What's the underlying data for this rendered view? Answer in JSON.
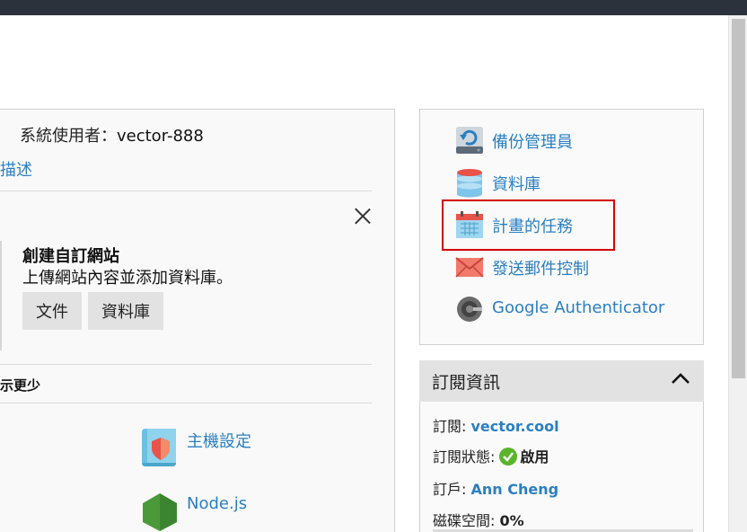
{
  "user": {
    "prefix": "系統使用者：",
    "name": "vector-888"
  },
  "left": {
    "desc_link": "描述",
    "card_title": "創建自訂網站",
    "card_subtitle": "上傳網站內容並添加資料庫。",
    "btn_files": "文件",
    "btn_database": "資料庫",
    "show_less": "示更少",
    "tools": [
      {
        "label": "主機設定",
        "icon": "hosting-settings-icon"
      },
      {
        "label": "Node.js",
        "icon": "nodejs-icon"
      }
    ]
  },
  "right": {
    "items": [
      {
        "label": "備份管理員",
        "icon": "backup-manager-icon"
      },
      {
        "label": "資料庫",
        "icon": "database-icon"
      },
      {
        "label": "計畫的任務",
        "icon": "calendar-icon"
      },
      {
        "label": "發送郵件控制",
        "icon": "mail-icon"
      },
      {
        "label": "Google Authenticator",
        "icon": "google-authenticator-icon"
      }
    ]
  },
  "subscription": {
    "title": "訂閱資訊",
    "subscription_label": "訂閱:",
    "subscription_value": "vector.cool",
    "status_label": "訂閱狀態:",
    "status_value": "啟用",
    "customer_label": "訂戶:",
    "customer_value": "Ann Cheng",
    "disk_label": "磁碟空間:",
    "disk_value": "0%"
  },
  "colors": {
    "link": "#2a7fc1",
    "topbar": "#2b323b",
    "highlight": "#d40000",
    "ok": "#5ab52a"
  }
}
